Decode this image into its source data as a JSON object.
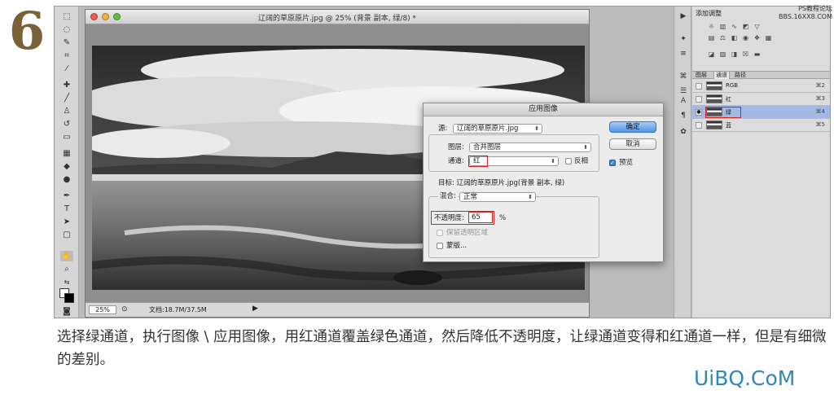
{
  "step_number": "6",
  "watermark": {
    "line1": "PS教程论坛",
    "line2": "BBS.16XX8.COM"
  },
  "document": {
    "title": "辽阔的草原原片.jpg @ 25% (背景 副本, 绿/8) *",
    "zoom": "25%",
    "doc_size": "文档:18.7M/37.5M"
  },
  "dialog": {
    "title": "应用图像",
    "source_label": "源:",
    "source_value": "辽阔的草原原片.jpg",
    "layer_label": "图层:",
    "layer_value": "合并图层",
    "channel_label": "通道:",
    "channel_value": "红",
    "invert_label": "反相",
    "target_text": "目标: 辽阔的草原原片.jpg(背景 副本, 绿)",
    "blending_label": "混合:",
    "blending_value": "正常",
    "opacity_label": "不透明度:",
    "opacity_value": "65",
    "opacity_unit": "%",
    "preserve_label": "保留透明区域",
    "mask_label": "蒙版...",
    "ok_label": "确定",
    "cancel_label": "取消",
    "preview_label": "预览"
  },
  "adjustments": {
    "title": "添加调整"
  },
  "channels_panel": {
    "tabs": [
      "图层",
      "通道",
      "路径"
    ],
    "active_tab": 1,
    "rows": [
      {
        "name": "RGB",
        "key": "⌘2",
        "selected": false
      },
      {
        "name": "红",
        "key": "⌘3",
        "selected": false
      },
      {
        "name": "绿",
        "key": "⌘4",
        "selected": true
      },
      {
        "name": "蓝",
        "key": "⌘5",
        "selected": false
      }
    ]
  },
  "caption": "选择绿通道，执行图像 \\ 应用图像，用红通道覆盖绿色通道，然后降低不透明度，让绿通道变得和红通道一样，但是有细微的差别。",
  "logo": "UiBQ.CoM",
  "colors": {
    "accent": "#3f86e0",
    "highlight": "#d21f1f",
    "step_badge": "#7a6238",
    "logo": "#2f86b8"
  }
}
